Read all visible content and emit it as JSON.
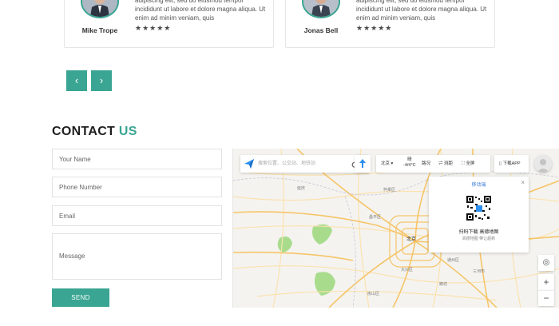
{
  "testimonials": [
    {
      "name": "Mike Trope",
      "text": "adipiscing elit, sed do eiusmod tempor incididunt ut labore et dolore magna aliqua. Ut enim ad minim veniam, quis",
      "stars": "★★★★★"
    },
    {
      "name": "Jonas Bell",
      "text": "adipiscing elit, sed do eiusmod tempor incididunt ut labore et dolore magna aliqua. Ut enim ad minim veniam, quis",
      "stars": "★★★★★"
    }
  ],
  "slider": {
    "prev": "‹",
    "next": "›"
  },
  "contact": {
    "title_main": "CONTACT",
    "title_accent": "US",
    "name_placeholder": "Your Name",
    "phone_placeholder": "Phone Number",
    "email_placeholder": "Email",
    "message_placeholder": "Message",
    "send_label": "SEND"
  },
  "map": {
    "search_placeholder": "搜索位置、公交站、地铁站",
    "city": "北京 ▾",
    "weather_top": "晴",
    "weather_bottom": "-4/4°C",
    "traffic": "路况",
    "measure": "测距",
    "fullscreen": "全屏",
    "download_app": "下载APP",
    "qr_title": "移动端",
    "qr_close": "×",
    "qr_line1": "扫码下载 高德地图",
    "qr_line2": "高德地图 带让超新",
    "zoom_in": "+",
    "zoom_out": "−",
    "locate": "◎",
    "labels": {
      "beijing": "北京",
      "langfang": "廊坊",
      "huairou": "怀柔区",
      "changping": "昌平区",
      "yanqing": "延庆",
      "daxing": "大兴区",
      "tongzhou": "通州区",
      "fangshan": "房山区",
      "sanhe": "三河市"
    },
    "colors": {
      "road_major": "#f6c56a",
      "road_minor": "#fbe2b0",
      "park": "#a8dc8c",
      "water": "#a8ccee"
    }
  },
  "colors": {
    "accent": "#3aa592"
  }
}
